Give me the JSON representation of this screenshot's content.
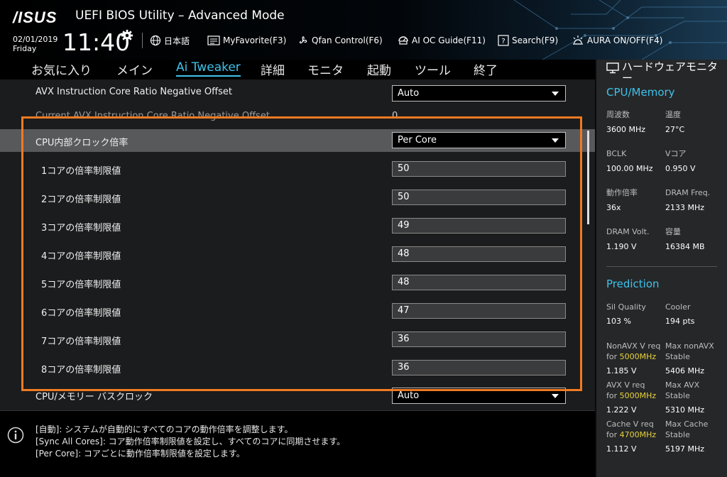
{
  "header": {
    "logo": "/ISUS",
    "title": "UEFI BIOS Utility – Advanced Mode",
    "date": "02/01/2019",
    "day": "Friday",
    "time": "11:40",
    "tools": [
      {
        "label": "日本語",
        "icon": "globe-icon"
      },
      {
        "label": "MyFavorite(F3)",
        "icon": "favorite-list-icon"
      },
      {
        "label": "Qfan Control(F6)",
        "icon": "fan-icon"
      },
      {
        "label": "AI OC Guide(F11)",
        "icon": "oc-guide-icon"
      },
      {
        "label": "Search(F9)",
        "icon": "search-question-icon"
      },
      {
        "label": "AURA ON/OFF(F4)",
        "icon": "aura-light-icon"
      }
    ]
  },
  "menu": [
    "お気に入り",
    "メイン",
    "Ai Tweaker",
    "詳細",
    "モニタ",
    "起動",
    "ツール",
    "終了"
  ],
  "settings": {
    "avx_offset": {
      "label": "AVX Instruction Core Ratio Negative Offset",
      "value": "Auto"
    },
    "current_avx": {
      "label": "Current AVX Instruction Core Ratio Negative Offset",
      "value": "0"
    },
    "cpu_ratio": {
      "label": "CPU内部クロック倍率",
      "value": "Per Core"
    },
    "cores": [
      {
        "label": "1コアの倍率制限値",
        "value": "50"
      },
      {
        "label": "2コアの倍率制限値",
        "value": "50"
      },
      {
        "label": "3コアの倍率制限値",
        "value": "49"
      },
      {
        "label": "4コアの倍率制限値",
        "value": "48"
      },
      {
        "label": "5コアの倍率制限値",
        "value": "48"
      },
      {
        "label": "6コアの倍率制限値",
        "value": "47"
      },
      {
        "label": "7コアの倍率制限値",
        "value": "36"
      },
      {
        "label": "8コアの倍率制限値",
        "value": "36"
      }
    ],
    "cpu_mem_bus": {
      "label": "CPU/メモリー バスクロック",
      "value": "Auto"
    }
  },
  "help": [
    "[自動]: システムが自動的にすべてのコアの動作倍率を調整します。",
    "[Sync All Cores]: コア動作倍率制限値を設定し、すべてのコアに同期させます。",
    "[Per Core]: コアごとに動作倍率制限値を設定します。"
  ],
  "hw": {
    "title": "ハードウェアモニター",
    "cpu_mem_title": "CPU/Memory",
    "freq_label": "周波数",
    "freq": "3600 MHz",
    "temp_label": "温度",
    "temp": "27°C",
    "bclk_label": "BCLK",
    "bclk": "100.00 MHz",
    "vcore_label": "Vコア",
    "vcore": "0.950 V",
    "ratio_label": "動作倍率",
    "ratio": "36x",
    "dram_freq_label": "DRAM Freq.",
    "dram_freq": "2133 MHz",
    "dram_volt_label": "DRAM Volt.",
    "dram_volt": "1.190 V",
    "capacity_label": "容量",
    "capacity": "16384 MB",
    "prediction_title": "Prediction",
    "sil_label": "Sil Quality",
    "sil": "103 %",
    "cooler_label": "Cooler",
    "cooler": "194 pts",
    "nonavx_l1": "NonAVX V req",
    "nonavx_for": "for ",
    "nonavx_mhz": "5000MHz",
    "nonavx_v": "1.185 V",
    "maxnonavx_l1": "Max nonAVX",
    "maxnonavx_l2": "Stable",
    "maxnonavx": "5406 MHz",
    "avx_l1": "AVX V req",
    "avx_for": "for ",
    "avx_mhz": "5000MHz",
    "avx_v": "1.222 V",
    "maxavx_l1": "Max AVX",
    "maxavx_l2": "Stable",
    "maxavx": "5310 MHz",
    "cache_l1": "Cache V req",
    "cache_for": "for ",
    "cache_mhz": "4700MHz",
    "cache_v": "1.112 V",
    "maxcache_l1": "Max Cache",
    "maxcache_l2": "Stable",
    "maxcache": "5197 MHz"
  }
}
